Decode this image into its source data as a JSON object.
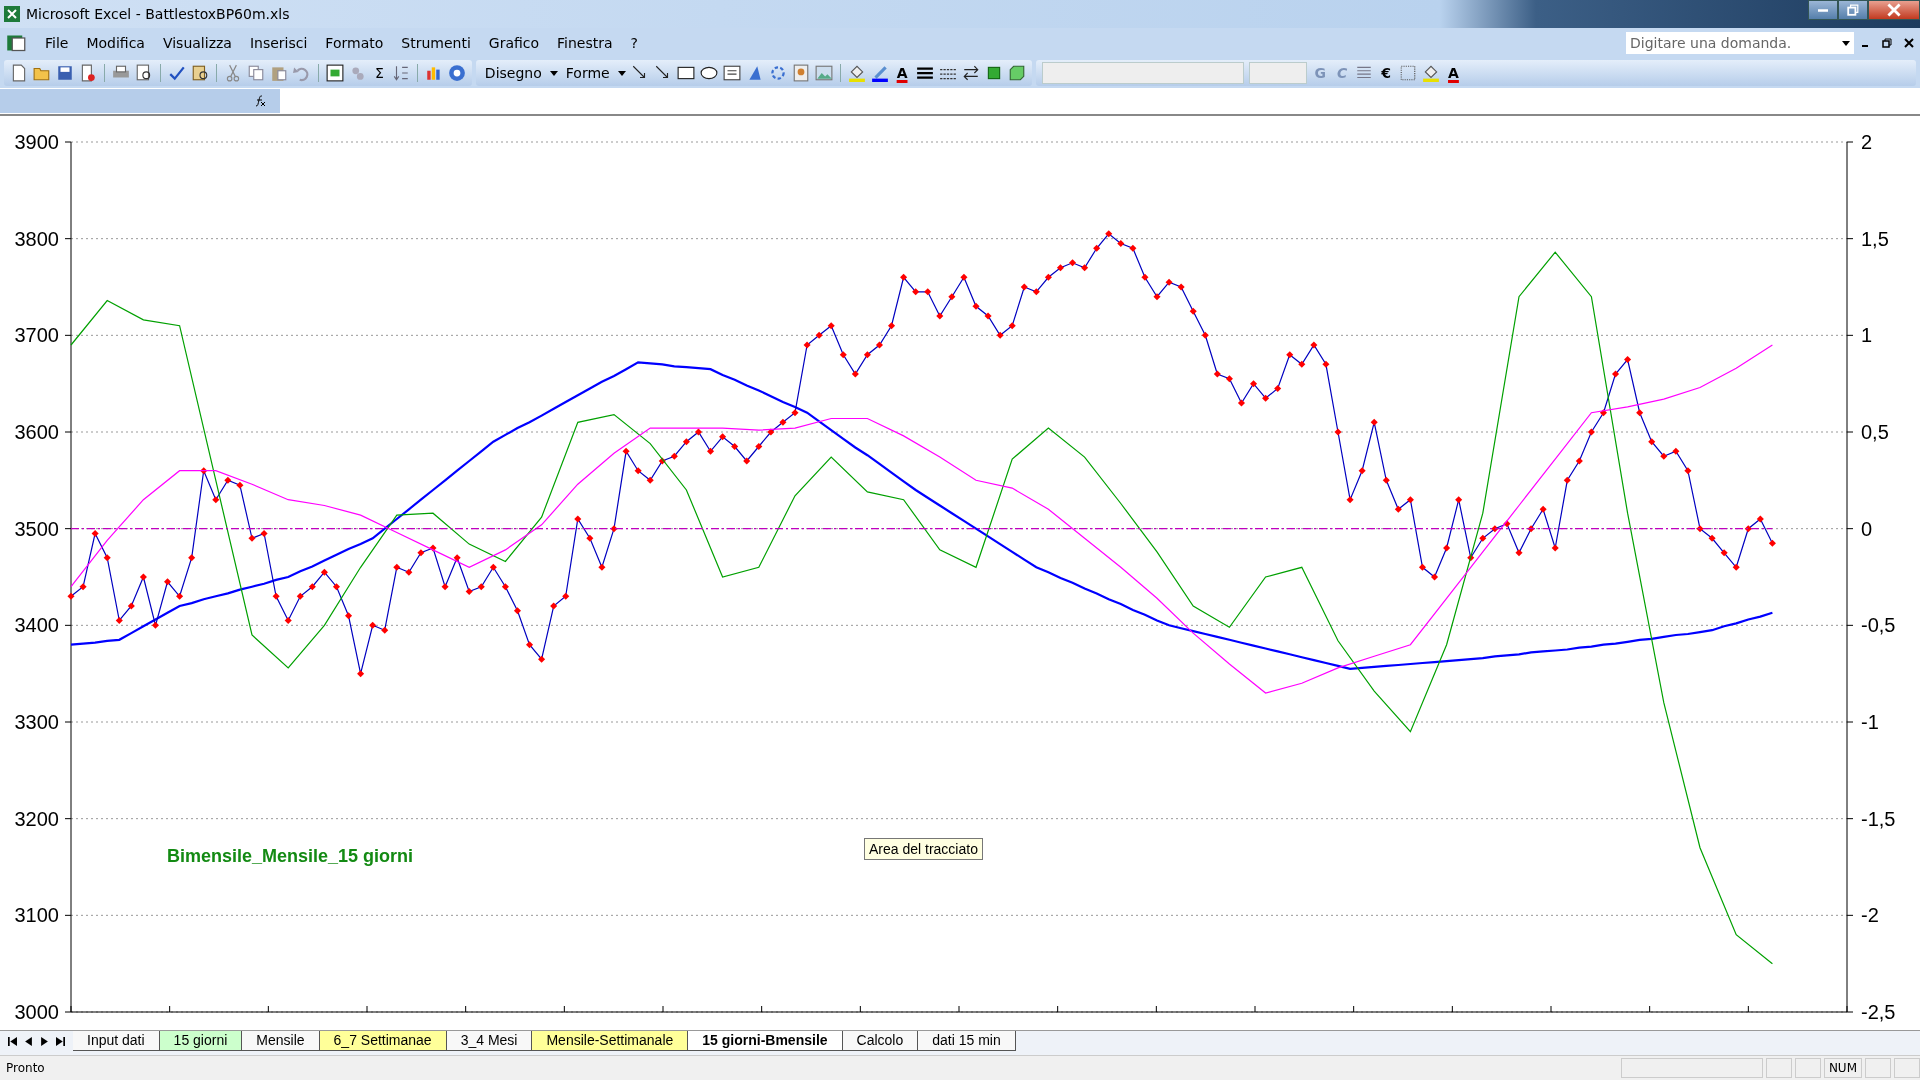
{
  "window": {
    "title": "Microsoft Excel - BattlestoxBP60m.xls"
  },
  "menu": [
    {
      "label": "File"
    },
    {
      "label": "Modifica"
    },
    {
      "label": "Visualizza"
    },
    {
      "label": "Inserisci"
    },
    {
      "label": "Formato"
    },
    {
      "label": "Strumenti"
    },
    {
      "label": "Grafico"
    },
    {
      "label": "Finestra"
    },
    {
      "label": "?"
    }
  ],
  "help_box": {
    "placeholder": "Digitare una domanda."
  },
  "toolbar": {
    "sum": "Σ",
    "drawing_menu": "Disegno",
    "shapes_menu": "Forme",
    "font_color": "A",
    "bold": "G",
    "italic": "C",
    "currency": "€",
    "font_color_2": "A"
  },
  "chart": {
    "tooltip": "Area del tracciato",
    "chart_data": {
      "type": "line",
      "grid": true,
      "title": "Bimensile_Mensile_15 giorni",
      "ylim": [
        3000,
        3900
      ],
      "yticks": [
        3000,
        3100,
        3200,
        3300,
        3400,
        3500,
        3600,
        3700,
        3800,
        3900
      ],
      "categories": [
        null,
        null,
        null,
        null,
        null,
        null,
        null,
        null,
        null,
        null,
        null,
        null,
        null,
        null,
        null,
        null,
        null,
        null,
        null,
        null,
        null,
        null,
        null,
        null,
        null,
        null,
        null,
        null,
        null,
        null,
        null,
        null,
        null,
        null,
        null,
        null,
        null,
        null,
        null,
        null,
        null,
        null,
        null,
        null,
        null,
        null,
        null,
        null,
        null,
        null,
        null,
        null,
        null,
        null,
        null,
        null,
        null,
        null,
        null,
        null,
        null,
        null,
        null,
        null,
        null,
        null,
        null,
        null,
        null,
        null,
        null,
        null,
        null,
        null,
        null,
        null,
        null,
        null,
        null,
        null,
        null,
        null,
        null,
        null,
        null,
        null,
        null,
        null,
        null,
        null,
        null,
        null,
        null,
        null,
        null,
        null,
        null,
        null,
        null,
        null,
        null,
        null,
        null,
        null,
        null,
        null,
        null,
        null,
        null,
        null,
        null,
        null,
        null,
        null,
        null,
        null,
        null,
        null,
        null,
        null,
        null,
        null,
        null,
        null,
        null,
        null,
        null,
        null,
        null,
        null,
        null,
        null,
        null,
        null,
        null,
        null,
        null,
        null,
        null,
        null,
        null,
        null
      ],
      "series": [
        {
          "color": "#0000ff",
          "values": [
            3380,
            3381,
            3382,
            3384,
            3385,
            3392,
            3399,
            3406,
            3413,
            3420,
            3423,
            3427,
            3430,
            3433,
            3437,
            3440,
            3443,
            3447,
            3450,
            3456,
            3461,
            3467,
            3473,
            3479,
            3484,
            3490,
            3500,
            3510,
            3520,
            3530,
            3540,
            3550,
            3560,
            3570,
            3580,
            3590,
            3597,
            3604,
            3610,
            3617,
            3624,
            3631,
            3638,
            3645,
            3652,
            3658,
            3665,
            3672,
            3671,
            3670,
            3668,
            3667,
            3666,
            3665,
            3659,
            3654,
            3648,
            3643,
            3637,
            3631,
            3626,
            3620,
            3611,
            3602,
            3593,
            3584,
            3576,
            3567,
            3558,
            3549,
            3540,
            3532,
            3524,
            3516,
            3508,
            3500,
            3492,
            3484,
            3476,
            3468,
            3460,
            3455,
            3449,
            3444,
            3438,
            3433,
            3427,
            3422,
            3416,
            3411,
            3405,
            3400,
            3397,
            3394,
            3391,
            3388,
            3385,
            3382,
            3379,
            3376,
            3373,
            3370,
            3367,
            3364,
            3361,
            3358,
            3355,
            3356,
            3357,
            3358,
            3359,
            3360,
            3361,
            3362,
            3363,
            3364,
            3365,
            3366,
            3368,
            3369,
            3370,
            3372,
            3373,
            3374,
            3375,
            3377,
            3378,
            3380,
            3381,
            3383,
            3385,
            3386,
            3388,
            3390,
            3391,
            3393,
            3395,
            3399,
            3402,
            3406,
            3409,
            3413
          ]
        },
        {
          "color": "#0000c0",
          "marker": "diamond",
          "values": [
            3430,
            3440,
            3495,
            3470,
            3405,
            3420,
            3450,
            3400,
            3445,
            3430,
            3470,
            3560,
            3530,
            3550,
            3545,
            3490,
            3495,
            3430,
            3405,
            3430,
            3440,
            3455,
            3440,
            3410,
            3350,
            3400,
            3395,
            3460,
            3455,
            3475,
            3480,
            3440,
            3470,
            3435,
            3440,
            3460,
            3440,
            3415,
            3380,
            3365,
            3420,
            3430,
            3510,
            3490,
            3460,
            3500,
            3580,
            3560,
            3550,
            3570,
            3575,
            3590,
            3600,
            3580,
            3595,
            3585,
            3570,
            3585,
            3600,
            3610,
            3620,
            3690,
            3700,
            3710,
            3680,
            3660,
            3680,
            3690,
            3710,
            3760,
            3745,
            3745,
            3720,
            3740,
            3760,
            3730,
            3720,
            3700,
            3710,
            3750,
            3745,
            3760,
            3770,
            3775,
            3770,
            3790,
            3805,
            3795,
            3790,
            3760,
            3740,
            3755,
            3750,
            3725,
            3700,
            3660,
            3655,
            3630,
            3650,
            3635,
            3645,
            3680,
            3670,
            3690,
            3670,
            3600,
            3530,
            3560,
            3610,
            3550,
            3520,
            3530,
            3460,
            3450,
            3480,
            3530,
            3470,
            3490,
            3500,
            3505,
            3475,
            3500,
            3520,
            3480,
            3550,
            3570,
            3600,
            3620,
            3660,
            3675,
            3620,
            3590,
            3575,
            3580,
            3560,
            3500,
            3490,
            3475,
            3460,
            3500,
            3510,
            3485
          ]
        }
      ]
    },
    "secondary": {
      "chart_data": {
        "type": "line",
        "ylim": [
          -2.5,
          2
        ],
        "yticks": [
          {
            "value": -2.5,
            "label": "-2,5"
          },
          {
            "value": -2,
            "label": "-2"
          },
          {
            "value": -1.5,
            "label": "-1,5"
          },
          {
            "value": -1,
            "label": "-1"
          },
          {
            "value": -0.5,
            "label": "-0,5"
          },
          {
            "value": 0,
            "label": "0"
          },
          {
            "value": 0.5,
            "label": "0,5"
          },
          {
            "value": 1,
            "label": "1"
          },
          {
            "value": 1.5,
            "label": "1,5"
          },
          {
            "value": 2,
            "label": "2"
          }
        ],
        "categories": [
          null,
          null,
          null,
          null,
          null,
          null,
          null,
          null,
          null,
          null,
          null,
          null,
          null,
          null,
          null,
          null,
          null,
          null,
          null,
          null,
          null,
          null,
          null,
          null,
          null,
          null,
          null,
          null,
          null,
          null,
          null,
          null,
          null,
          null,
          null,
          null,
          null,
          null,
          null,
          null,
          null,
          null,
          null,
          null,
          null,
          null,
          null,
          null
        ],
        "series": [
          {
            "color": "#00a000",
            "values": [
              0.95,
              1.18,
              1.08,
              1.05,
              0.25,
              -0.55,
              -0.72,
              -0.5,
              -0.2,
              0.07,
              0.08,
              -0.08,
              -0.17,
              0.06,
              0.55,
              0.59,
              0.44,
              0.2,
              -0.25,
              -0.2,
              0.17,
              0.37,
              0.19,
              0.15,
              -0.11,
              -0.2,
              0.36,
              0.52,
              0.37,
              0.13,
              -0.12,
              -0.4,
              -0.51,
              -0.25,
              -0.2,
              -0.58,
              -0.84,
              -1.05,
              -0.6,
              0.08,
              1.2,
              1.43,
              1.2,
              0.08,
              -0.9,
              -1.65,
              -2.1,
              -2.25
            ]
          },
          {
            "color": "#ff00ff",
            "values": [
              -0.3,
              -0.06,
              0.15,
              0.3,
              0.3,
              0.23,
              0.15,
              0.12,
              0.07,
              -0.02,
              -0.11,
              -0.2,
              -0.11,
              0.02,
              0.23,
              0.39,
              0.52,
              0.52,
              0.52,
              0.51,
              0.52,
              0.57,
              0.57,
              0.48,
              0.37,
              0.25,
              0.21,
              0.1,
              -0.05,
              -0.2,
              -0.36,
              -0.54,
              -0.7,
              -0.85,
              -0.8,
              -0.72,
              -0.66,
              -0.6,
              -0.36,
              -0.12,
              0.12,
              0.36,
              0.6,
              0.63,
              0.67,
              0.73,
              0.83,
              0.95
            ]
          },
          {
            "color": "#c000c0",
            "line_style": "dashdot",
            "values": [
              0,
              0,
              0,
              0,
              0,
              0,
              0,
              0,
              0,
              0,
              0,
              0,
              0,
              0,
              0,
              0,
              0,
              0,
              0,
              0,
              0,
              0,
              0,
              0,
              0,
              0,
              0,
              0,
              0,
              0,
              0,
              0,
              0,
              0,
              0,
              0,
              0,
              0,
              0,
              0,
              0,
              0,
              0,
              0,
              0,
              0,
              0,
              0
            ]
          }
        ]
      }
    }
  },
  "sheet_tabs": [
    {
      "label": "Input dati",
      "selected": false
    },
    {
      "label": "15 giorni",
      "selected": false,
      "color": "#ccffcc"
    },
    {
      "label": "Mensile",
      "selected": false
    },
    {
      "label": "6_7 Settimanae",
      "selected": false,
      "color": "#ffff99"
    },
    {
      "label": "3_4 Mesi",
      "selected": false
    },
    {
      "label": "Mensile-Settimanale",
      "selected": false,
      "color": "#ffff99"
    },
    {
      "label": "15 giorni-Bmensile",
      "selected": true
    },
    {
      "label": "Calcolo",
      "selected": false
    },
    {
      "label": "dati 15 min",
      "selected": false
    }
  ],
  "status_bar": {
    "text": "Pronto",
    "indicator": "NUM"
  }
}
